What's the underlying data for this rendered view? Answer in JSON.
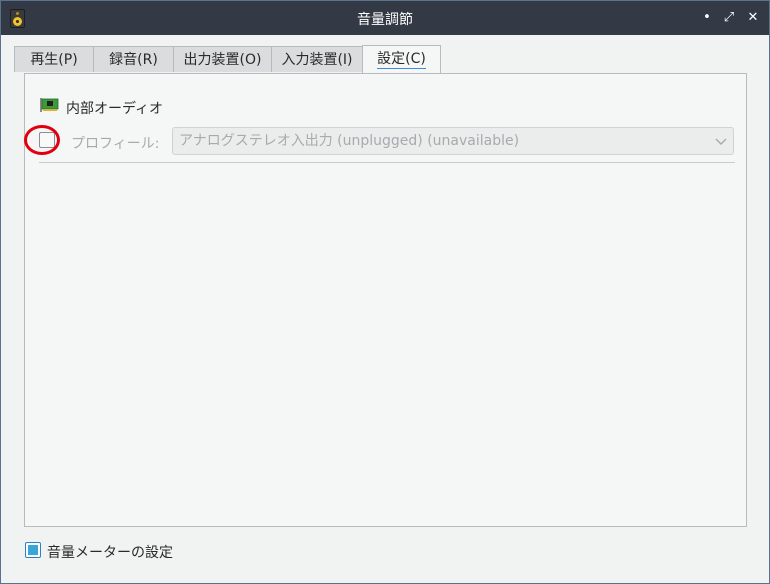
{
  "window": {
    "title": "音量調節",
    "controls": {
      "minimize": "•",
      "maximize": "⤢",
      "close": "✕"
    }
  },
  "tabs": [
    {
      "label": "再生(P)"
    },
    {
      "label": "録音(R)"
    },
    {
      "label": "出力装置(O)"
    },
    {
      "label": "入力装置(I)"
    },
    {
      "label": "設定(C)",
      "active": true
    }
  ],
  "config": {
    "card_name": "内部オーディオ",
    "card_icon": "sound-card-icon",
    "profile_enabled": false,
    "profile_label": "プロフィール:",
    "profile_value": "アナログステレオ入出力 (unplugged) (unavailable)",
    "profile_disabled": true
  },
  "footer": {
    "meter_label": "音量メーターの設定",
    "meter_checked": true
  },
  "colors": {
    "titlebar": "#333a45",
    "accent": "#3aa5d8",
    "highlight_ring": "#e3000e"
  }
}
